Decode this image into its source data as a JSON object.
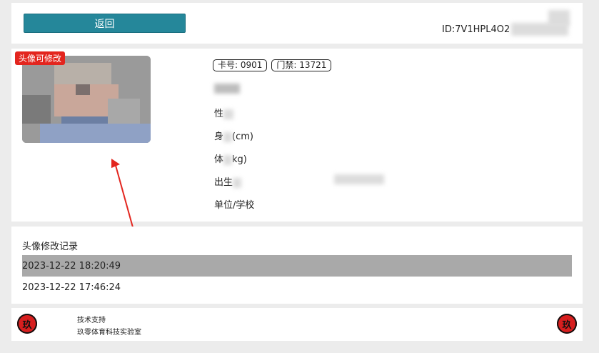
{
  "top": {
    "back_label": "返回",
    "device_id": "ID:7V1HPL4O2"
  },
  "profile": {
    "avatar_tag": "头像可修改",
    "card_no": "卡号: 0901",
    "door_no": "门禁: 13721",
    "gender_label": "性",
    "height_label": "身",
    "height_unit": "(cm)",
    "weight_label": "体",
    "weight_unit": "kg)",
    "birth_label": "出生",
    "unit_label": "单位/学校"
  },
  "history": {
    "title": "头像修改记录",
    "rows": [
      "2023-12-22 18:20:49",
      "2023-12-22 17:46:24"
    ]
  },
  "footer": {
    "line1": "技术支持",
    "line2": "玖零体育科技实验室",
    "logo_char": "玖"
  },
  "colors": {
    "accent": "#25879a",
    "tag_red": "#e3251e",
    "selected_row": "#a9a9a9"
  }
}
